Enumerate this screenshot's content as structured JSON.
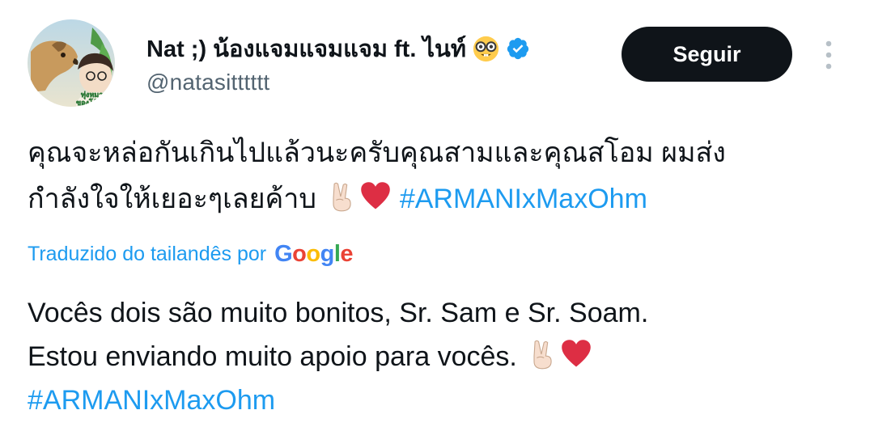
{
  "author": {
    "display_name": "Nat ;) น้องแจมแจมแจม ft. ไนท์",
    "handle": "@natasitttttt",
    "avatar_text": "ทุ่งหมา\nของโอ๊ะ",
    "badge": "verified-icon",
    "name_emoji": "nerd-face-icon"
  },
  "follow_button": {
    "label": "Seguir"
  },
  "more_menu": {
    "icon": "more-vertical-icon"
  },
  "tweet": {
    "thai_line1": "คุณจะหล่อกันเกินไปแล้วนะครับคุณสามและคุณสโอม ผมส่ง",
    "thai_line2": "กำลังใจให้เยอะๆเลยค้าบ",
    "hashtag": "#ARMANIxMaxOhm"
  },
  "translation": {
    "label": "Traduzido do tailandês por",
    "provider": "Google",
    "line1": "Vocês dois são muito bonitos, Sr. Sam e Sr. Soam.",
    "line2": "Estou enviando muito apoio para vocês.",
    "hashtag": "#ARMANIxMaxOhm"
  },
  "colors": {
    "link": "#1d9bf0",
    "text": "#0f1419",
    "secondary": "#536471",
    "button_bg": "#0f1419"
  }
}
